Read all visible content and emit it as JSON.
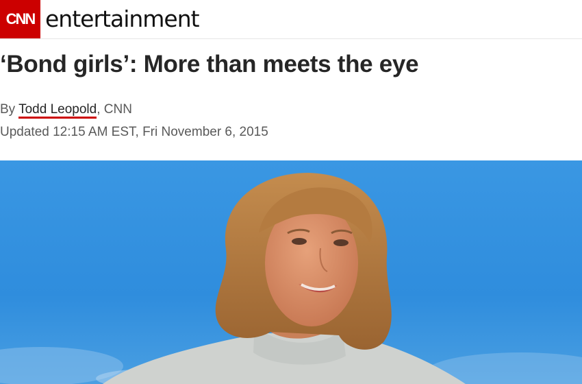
{
  "header": {
    "logo_text": "CNN",
    "section_name": "entertainment",
    "logo_color": "#cc0000"
  },
  "article": {
    "headline": "‘Bond girls’: More than meets the eye",
    "byline_prefix": "By ",
    "author": "Todd Leopold",
    "byline_suffix": ", CNN",
    "updated": "Updated 12:15 AM EST, Fri November 6, 2015"
  },
  "hero_image": {
    "subject": "woman-portrait-blue-sky",
    "sky_color": "#2f8fe0",
    "hair_color": "#b07a3c",
    "sweater_color": "#cfd2cf"
  }
}
